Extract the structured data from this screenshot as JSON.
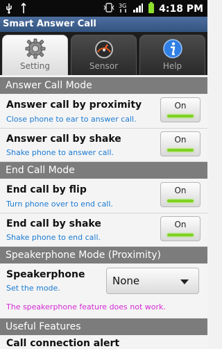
{
  "status_bar": {
    "time": "4:18 PM",
    "icons": [
      "usb-icon",
      "vibrate-icon",
      "3g-icon",
      "signal-icon",
      "battery-icon",
      "usb-plug-icon"
    ]
  },
  "app": {
    "title": "Smart Answer Call"
  },
  "tabs": [
    {
      "label": "Setting",
      "icon": "gear-icon"
    },
    {
      "label": "Sensor",
      "icon": "gauge-icon"
    },
    {
      "label": "Help",
      "icon": "info-icon"
    }
  ],
  "sections": {
    "answer": "Answer Call Mode",
    "end": "End Call Mode",
    "speaker": "Speakerphone Mode (Proximity)",
    "useful": "Useful Features"
  },
  "answer_items": [
    {
      "title": "Answer call by proximity",
      "subtitle": "Close phone to ear to answer call.",
      "toggle": "On"
    },
    {
      "title": "Answer call by shake",
      "subtitle": "Shake phone to answer call.",
      "toggle": "On"
    }
  ],
  "end_items": [
    {
      "title": "End call by flip",
      "subtitle": "Turn phone over to end call.",
      "toggle": "On"
    },
    {
      "title": "End call by shake",
      "subtitle": "Shake phone to end call.",
      "toggle": "On"
    }
  ],
  "speaker": {
    "title": "Speakerphone",
    "subtitle": "Set the mode.",
    "selected": "None",
    "note": "The speakerphone feature does not work."
  },
  "useful": {
    "partial_item": "Call connection alert"
  },
  "colors": {
    "accent_blue": "#1a7bd2",
    "toggle_green": "#7ed321",
    "note_magenta": "#d42ad4"
  }
}
